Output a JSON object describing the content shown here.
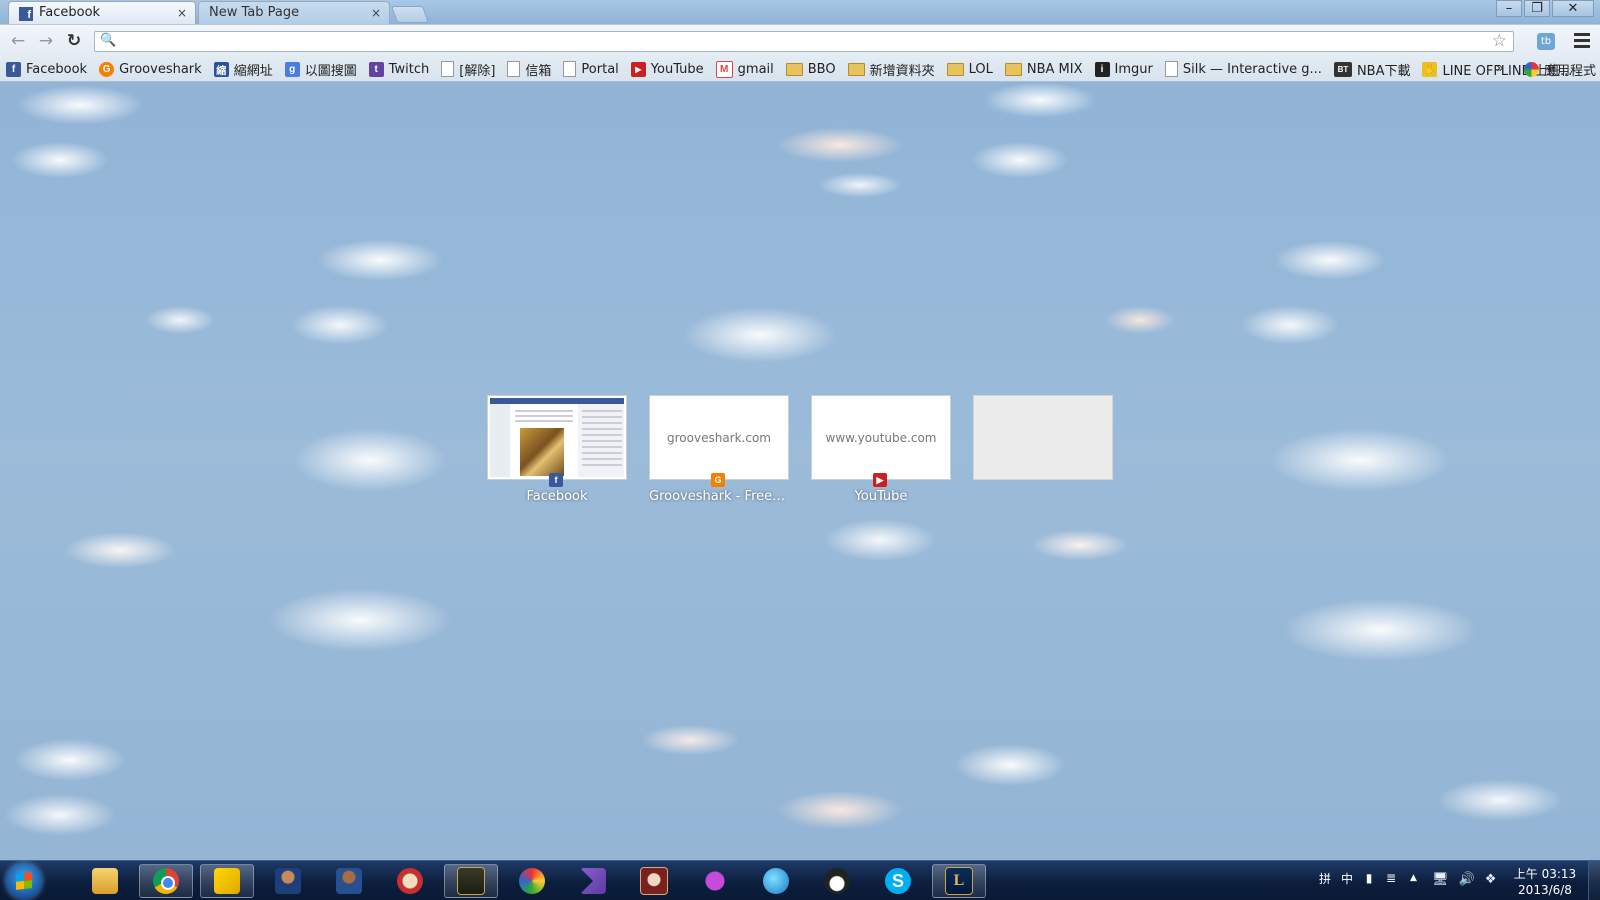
{
  "tabs": [
    {
      "title": "Facebook",
      "active": true
    },
    {
      "title": "New Tab Page",
      "active": false
    }
  ],
  "tab_close_glyph": "×",
  "window_controls": {
    "minimize": "–",
    "restore": "❐",
    "close": "✕"
  },
  "toolbar": {
    "back_glyph": "←",
    "forward_glyph": "→",
    "reload_glyph": "↻",
    "search_glyph": "🔍",
    "omnibox_value": "",
    "star_glyph": "☆",
    "extension_label": "tb"
  },
  "bookmarks": [
    {
      "label": "Facebook",
      "icon": "facebook-icon",
      "glyph": "f"
    },
    {
      "label": "Grooveshark",
      "icon": "grooveshark-icon",
      "glyph": "G"
    },
    {
      "label": "縮網址",
      "icon": "shorten-url-icon",
      "glyph": "縮"
    },
    {
      "label": "以圖搜圖",
      "icon": "google-icon",
      "glyph": "g"
    },
    {
      "label": "Twitch",
      "icon": "twitch-icon",
      "glyph": "t"
    },
    {
      "label": "[解除]",
      "icon": "page-icon",
      "glyph": ""
    },
    {
      "label": "信箱",
      "icon": "page-icon",
      "glyph": ""
    },
    {
      "label": "Portal",
      "icon": "page-icon",
      "glyph": ""
    },
    {
      "label": "YouTube",
      "icon": "youtube-icon",
      "glyph": "▶"
    },
    {
      "label": "gmail",
      "icon": "gmail-icon",
      "glyph": "M"
    },
    {
      "label": "BBO",
      "icon": "folder-icon",
      "glyph": ""
    },
    {
      "label": "新增資料夾",
      "icon": "folder-icon",
      "glyph": ""
    },
    {
      "label": "LOL",
      "icon": "folder-icon",
      "glyph": ""
    },
    {
      "label": "NBA MIX",
      "icon": "folder-icon",
      "glyph": ""
    },
    {
      "label": "Imgur",
      "icon": "imgur-icon",
      "glyph": "i"
    },
    {
      "label": "Silk — Interactive g...",
      "icon": "page-icon",
      "glyph": ""
    },
    {
      "label": "NBA下載",
      "icon": "bt-icon",
      "glyph": "BT"
    },
    {
      "label": "LINE OFFLINE 上班...",
      "icon": "line-icon",
      "glyph": "✋"
    }
  ],
  "bookmarks_overflow": "»",
  "apps_label": "應用程式",
  "most_visited": [
    {
      "title": "Facebook",
      "domain": "",
      "fav_glyph": "f",
      "fav_color": "#3b5998",
      "kind": "screenshot"
    },
    {
      "title": "Grooveshark - Free Mu...",
      "domain": "grooveshark.com",
      "fav_glyph": "G",
      "fav_color": "#f77f00",
      "kind": "text"
    },
    {
      "title": "YouTube",
      "domain": "www.youtube.com",
      "fav_glyph": "▶",
      "fav_color": "#cc1f1f",
      "kind": "text"
    },
    {
      "title": "",
      "domain": "",
      "fav_glyph": "",
      "fav_color": "",
      "kind": "empty"
    }
  ],
  "taskbar": {
    "apps": [
      {
        "name": "explorer-icon",
        "glyph": "",
        "cls": "g-explorer"
      },
      {
        "name": "chrome-icon",
        "glyph": "",
        "cls": "g-chrome",
        "active": true
      },
      {
        "name": "pen-app-icon",
        "glyph": "",
        "cls": "g-pen",
        "active": true
      },
      {
        "name": "player-avatar-icon",
        "glyph": "",
        "cls": "g-hero1"
      },
      {
        "name": "player-avatar-icon-2",
        "glyph": "",
        "cls": "g-hero2"
      },
      {
        "name": "game-icon",
        "glyph": "",
        "cls": "g-game"
      },
      {
        "name": "lol-old-icon",
        "glyph": "",
        "cls": "g-lol-old",
        "active": true
      },
      {
        "name": "paint-icon",
        "glyph": "",
        "cls": "g-paint"
      },
      {
        "name": "visual-studio-icon",
        "glyph": "",
        "cls": "g-vs"
      },
      {
        "name": "character-icon",
        "glyph": "",
        "cls": "g-char"
      },
      {
        "name": "yahoo-messenger-icon",
        "glyph": "",
        "cls": "g-yahoo"
      },
      {
        "name": "globe-icon",
        "glyph": "",
        "cls": "g-globe"
      },
      {
        "name": "tux-icon",
        "glyph": "",
        "cls": "g-tux"
      },
      {
        "name": "skype-icon",
        "glyph": "S",
        "cls": "g-skype"
      },
      {
        "name": "league-client-icon",
        "glyph": "L",
        "cls": "g-league",
        "active": true
      }
    ],
    "ime": [
      "拼",
      "中",
      "▮",
      "≣"
    ],
    "tray_arrow": "▲",
    "tray_icons": [
      "🖥",
      "🔊",
      "❖"
    ],
    "clock_time": "上午 03:13",
    "clock_date": "2013/6/8"
  }
}
